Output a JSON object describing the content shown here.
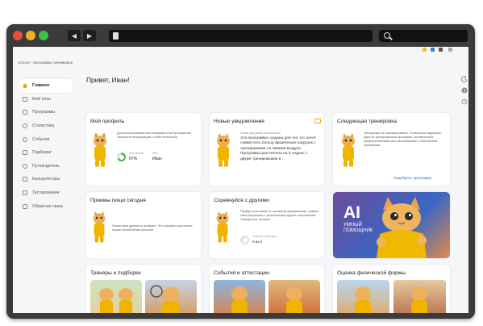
{
  "sidebar": {
    "items": [
      {
        "label": "Главное"
      },
      {
        "label": "Мой план"
      },
      {
        "label": "Программы"
      },
      {
        "label": "Статистика"
      },
      {
        "label": "События"
      },
      {
        "label": "Подборки"
      },
      {
        "label": "Путеводитель"
      },
      {
        "label": "Калькуляторы"
      },
      {
        "label": "Тестирование"
      },
      {
        "label": "Обратная связь"
      }
    ]
  },
  "header": {
    "breadcrumb": "1Спорт - программы тренировок",
    "greeting": "Привет, Иван!"
  },
  "cards": {
    "profile": {
      "title": "Мой профиль",
      "text": "Для использования всех возможностей приложения заполните информацию о себе полностью.",
      "progress_label": "Заполнение",
      "progress_value": "67%",
      "name_label": "Имя",
      "name_value": "Иван",
      "progress": 0.67
    },
    "notifications": {
      "title": "Новые уведомления",
      "subtitle": "Новая программа для возраста",
      "text": "Эта программа создана для тех, кто хочет совместить пользу физических нагрузок с тренировками на свежем воздухе. Программа рассчитана на 6 недель с двумя тренировками в ..."
    },
    "next_workout": {
      "title": "Следующая тренировка",
      "text": "Тренировки не запланированы. Ты можешь подобрать одну из тренировочных программ, составленных профессионалами или запланировать собственные тренировки",
      "link": "Подобрать программу"
    },
    "meals": {
      "title": "Приемы пищи сегодня",
      "text": "Укажи свои данные в профиле. Это поможет рассчитать нормы потребления калорий"
    },
    "compete": {
      "title": "Соревнуйся с другими",
      "text": "Пройди испытания по основным упражнениям, сравни свои результаты с результатами других спортсменов. Определите лучшего",
      "stat_label": "Участие в рейтинге",
      "stat_value": "0 из 6"
    },
    "ai": {
      "big": "AI",
      "small1": "УМНЫЙ",
      "small2": "ПОМОЩНИК"
    },
    "trainers": {
      "title": "Тренеры и подборки"
    },
    "events": {
      "title": "События и аттестации"
    },
    "fitness": {
      "title": "Оценка физической формы"
    }
  },
  "icons": {
    "tools": [
      "moon-icon",
      "info-icon",
      "history-icon"
    ],
    "mail": "mail-icon"
  },
  "colors": {
    "accent": "#f0a600",
    "link": "#2f6fd6",
    "progress": "#3eb84a"
  }
}
